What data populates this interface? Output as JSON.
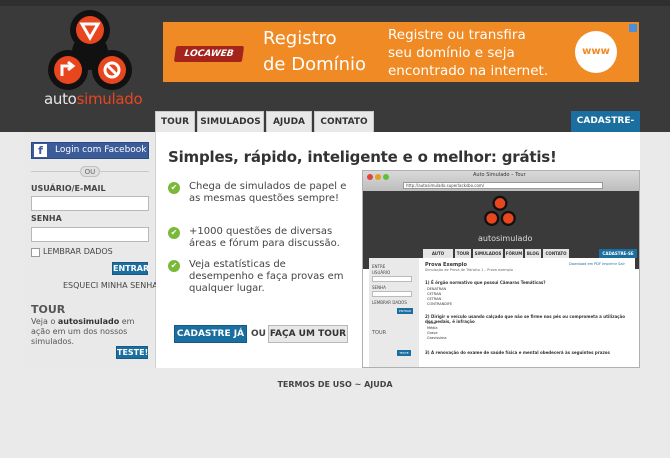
{
  "logo": {
    "prefix": "auto",
    "suffix": "simulado"
  },
  "ad": {
    "badge": "LOCAWEB",
    "title_line1": "Registro",
    "title_line2": "de Domínio",
    "text_line1": "Registre ou transfira",
    "text_line2": "seu domínio e seja",
    "text_line3": "encontrado na internet.",
    "www_icon": "www"
  },
  "nav": {
    "tabs": [
      "TOUR",
      "SIMULADOS",
      "AJUDA",
      "CONTATO"
    ],
    "signup": "CADASTRE-SE"
  },
  "login": {
    "facebook": "Login com Facebook",
    "or": "OU",
    "user_label": "USUÁRIO/E-MAIL",
    "user_value": "",
    "password_label": "SENHA",
    "password_value": "",
    "remember": "LEMBRAR DADOS",
    "enter": "ENTRAR",
    "forgot": "ESQUECI MINHA SENHA"
  },
  "tour": {
    "heading": "TOUR",
    "text_before": "Veja o ",
    "text_bold": "autosimulado",
    "text_after": " em ação em um dos nossos simulados.",
    "button": "TESTE!"
  },
  "main": {
    "headline": "Simples, rápido, inteligente e o melhor: grátis!",
    "features": [
      "Chega de simulados de papel e as mesmas questões sempre!",
      "+1000 questões de diversas áreas e fórum para discussão.",
      "Veja estatísticas de desempenho e faça provas em qualquer lugar."
    ],
    "cta_primary": "CADASTRE JÁ",
    "or": "OU",
    "cta_secondary": "FAÇA UM TOUR"
  },
  "preview": {
    "window_title": "Auto Simulado – Tour",
    "url": "http://autosimulado.superlacksbo.com/",
    "logo": "autosimulado",
    "tabs": [
      "AUTO ESCOLAS",
      "TOUR",
      "SIMULADOS",
      "FÓRUM",
      "BLOG",
      "CONTATO"
    ],
    "signup": "CADASTRE-SE",
    "exam_title": "Prova Exemplo",
    "exam_sub": "Simulação de Prova de Trânsito 1 – Prova exemplo",
    "actions": "Download em PDF   Imprimir   Sair",
    "question1": "1) É órgão normativo que possui Câmaras Temáticas?",
    "options1": [
      "DENATRAN",
      "CETRAN",
      "CETRAN",
      "CONTRANDIFE"
    ],
    "question2": "2) Dirigir o veículo usando calçado que não se firme nos pés ou comprometa a utilização dos pedais, é infração",
    "options2": [
      "Leve",
      "Média",
      "Grave",
      "Gravíssima"
    ],
    "question3": "3) A renovação do exame de saúde física e mental obedecerá às seguintes prazos",
    "login_labels": [
      "ENTRE",
      "USUÁRIO",
      "SENHA"
    ],
    "remember": "LEMBRAR DADOS",
    "enter": "ENTRAR",
    "tour": "TOUR",
    "test": "TESTE"
  },
  "footer": {
    "terms": "TERMOS DE USO",
    "sep": " ~ ",
    "help": "AJUDA"
  },
  "colors": {
    "accent": "#1b6ea0",
    "brand": "#e8461f",
    "ad": "#f08a24",
    "check": "#7ab83a"
  }
}
